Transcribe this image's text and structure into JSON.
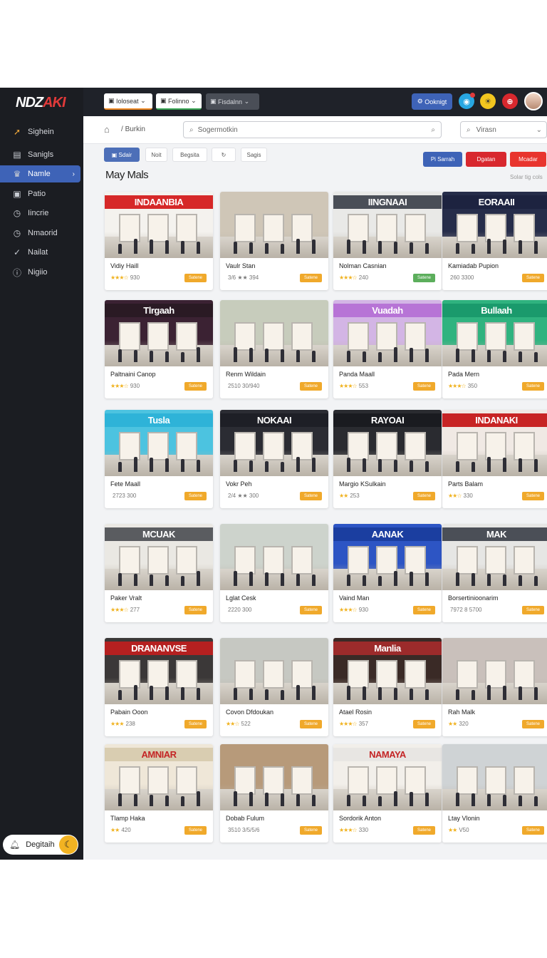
{
  "brand": {
    "logo_main": "NDZ",
    "logo_accent": "AKI"
  },
  "sidebar": {
    "items": [
      {
        "label": "Sighein",
        "icon": "compass-icon",
        "glyph": "➚"
      },
      {
        "label": "Sanigls",
        "icon": "grid-icon",
        "glyph": "▤"
      },
      {
        "label": "Namle",
        "icon": "crown-icon",
        "glyph": "♛",
        "active": true
      },
      {
        "label": "Patio",
        "icon": "image-icon",
        "glyph": "▣"
      },
      {
        "label": "Iincrie",
        "icon": "clock-icon",
        "glyph": "◷"
      },
      {
        "label": "Nmaorid",
        "icon": "clock-icon",
        "glyph": "◷"
      },
      {
        "label": "Nailat",
        "icon": "check-icon",
        "glyph": "✓"
      },
      {
        "label": "Nigiio",
        "icon": "info-icon",
        "glyph": "ⓘ"
      }
    ],
    "theme_toggle_label": "Degitaih"
  },
  "topbar": {
    "pill1": "Ioloseat",
    "pill2": "Folinno",
    "pill3": "Fisdalnn",
    "right_button": "Ooknigt"
  },
  "search": {
    "breadcrumb": "Burkin",
    "placeholder": "Sogermotkin",
    "filter_value": "Virasn"
  },
  "chips": [
    "Sdair",
    "Noit",
    "Begsita",
    "",
    "Sagis"
  ],
  "actions": [
    "Pi Sarrah",
    "Dgatan",
    "Mcadar"
  ],
  "section_title": "May Mals",
  "sort_label": "Solar tig cols",
  "colors": {
    "accent": "#3e63b7",
    "danger": "#d8282e",
    "badge": "#f0a92b",
    "sidebar": "#1b1d22"
  },
  "cards": [
    {
      "name": "Vidiy Haill",
      "rating": "930",
      "stars": "★★★☆",
      "sign": "INDAANBIA",
      "signbg": "#d62828",
      "wall": "#f4f2ee",
      "badge": "Satene"
    },
    {
      "name": "Vaulr Stan",
      "rating": "3/6 ★★ 394",
      "stars": "",
      "sign": "",
      "signbg": "",
      "wall": "#cfc6b7",
      "badge": "Satene"
    },
    {
      "name": "Nolman Casnian",
      "rating": "240",
      "stars": "★★★☆",
      "sign": "IINGNAAI",
      "signbg": "#4a4e57",
      "wall": "#e9e9e7",
      "badge": "Satene",
      "badge_green": true
    },
    {
      "name": "Kamiadab Pupion",
      "rating": "260 3300",
      "stars": "",
      "sign": "EORAAII",
      "signbg": "#1d2340",
      "wall": "#262d4a",
      "badge": "Satene"
    },
    {
      "name": "Paltnaini Canop",
      "rating": "930",
      "stars": "★★★☆",
      "sign": "Tlrgaah",
      "signbg": "#2a1a24",
      "wall": "#3b2233",
      "badge": "Satene"
    },
    {
      "name": "Renm Wildain",
      "rating": "2510 30/940",
      "stars": "",
      "sign": "",
      "signbg": "",
      "wall": "#c7ccbc",
      "badge": "Satene"
    },
    {
      "name": "Panda Maall",
      "rating": "553",
      "stars": "★★★☆",
      "sign": "Vuadah",
      "signbg": "#b774d6",
      "wall": "#d3b5e5",
      "badge": "Satene"
    },
    {
      "name": "Pada Mern",
      "rating": "350",
      "stars": "★★★☆",
      "sign": "Bullaah",
      "signbg": "#1a9a6c",
      "wall": "#2fb37f",
      "badge": "Satene"
    },
    {
      "name": "Fete Maall",
      "rating": "2723 300",
      "stars": "",
      "sign": "Tusla",
      "signbg": "#2eb3d8",
      "wall": "#4cc3e0",
      "badge": "Satene"
    },
    {
      "name": "Vokr Peh",
      "rating": "2/4 ★★ 300",
      "stars": "",
      "sign": "NOKAAI",
      "signbg": "#1e1f26",
      "wall": "#2b2c33",
      "badge": "Satene"
    },
    {
      "name": "Margio KSulkain",
      "rating": "253",
      "stars": "★★",
      "sign": "RAYOAI",
      "signbg": "#1a1b20",
      "wall": "#2a2b30",
      "badge": "Satene"
    },
    {
      "name": "Parts Balam",
      "rating": "330",
      "stars": "★★☆",
      "sign": "INDANAKI",
      "signbg": "#c72424",
      "wall": "#f0e9e4",
      "badge": "Satene"
    },
    {
      "name": "Paker Vralt",
      "rating": "277",
      "stars": "★★★☆",
      "sign": "MCUAK",
      "signbg": "#5a5c60",
      "wall": "#eae8e3",
      "badge": "Satene"
    },
    {
      "name": "Lglat Cesk",
      "rating": "2220 300",
      "stars": "",
      "sign": "",
      "signbg": "",
      "wall": "#cdd3cc",
      "badge": "Satene"
    },
    {
      "name": "Vaind Man",
      "rating": "930",
      "stars": "★★★☆",
      "sign": "AANAK",
      "signbg": "#1b3ea0",
      "wall": "#2d55c4",
      "badge": "Satene"
    },
    {
      "name": "Borsertinioonarim",
      "rating": "7972 8 5700",
      "stars": "",
      "sign": "MAK",
      "signbg": "#4b4f57",
      "wall": "#e6e6e4",
      "badge": "Satene"
    },
    {
      "name": "Pabain Ooon",
      "rating": "238",
      "stars": "★★★",
      "sign": "DRANANVSE",
      "signbg": "#b52020",
      "wall": "#3b3838",
      "badge": "Satene"
    },
    {
      "name": "Covon Dfdoukan",
      "rating": "522",
      "stars": "★★☆",
      "sign": "",
      "signbg": "",
      "wall": "#c6c8c2",
      "badge": "Satene"
    },
    {
      "name": "Atael Rosin",
      "rating": "357",
      "stars": "★★★☆",
      "sign": "Manlia",
      "signbg": "#9c2b2b",
      "wall": "#3a2a26",
      "badge": "Satene"
    },
    {
      "name": "Rah Malk",
      "rating": "320",
      "stars": "★★",
      "sign": "",
      "signbg": "",
      "wall": "#c9c0bb",
      "badge": "Satene"
    },
    {
      "name": "Tlamp Haka",
      "rating": "420",
      "stars": "★★",
      "sign": "AMNIAR",
      "signbg": "#d9cdb1",
      "wall": "#efe7d8",
      "badge": "Satene"
    },
    {
      "name": "Dobab Fulum",
      "rating": "3510 3/5/5/6",
      "stars": "",
      "sign": "",
      "signbg": "",
      "wall": "#b79a7a",
      "badge": "Satene"
    },
    {
      "name": "Sordorik Anton",
      "rating": "330",
      "stars": "★★★☆",
      "sign": "NAMAYA",
      "signbg": "#e8e6e3",
      "wall": "#f2efea",
      "badge": "Satene"
    },
    {
      "name": "Ltay Vlonin",
      "rating": "V50",
      "stars": "★★",
      "sign": "",
      "signbg": "",
      "wall": "#cfd3d5",
      "badge": "Satene"
    }
  ]
}
